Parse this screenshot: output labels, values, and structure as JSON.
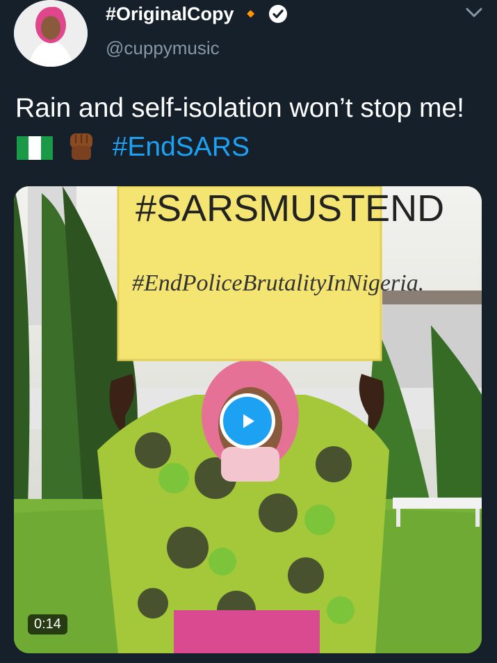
{
  "tweet": {
    "display_name": "#OriginalCopy 🔸",
    "handle": "@cuppymusic",
    "text_main": "Rain and self-isolation won’t stop me!",
    "hashtag": "#EndSARS",
    "emoji": {
      "flag": "nigeria-flag-icon",
      "fist": "raised-fist-icon"
    },
    "video": {
      "duration": "0:14",
      "sign_line1": "#SARSMUSTEND",
      "sign_line2": "#EndPoliceBrutalityInNigeria."
    }
  },
  "colors": {
    "background": "#15202b",
    "secondary_text": "#8899a6",
    "accent": "#1da1f2"
  }
}
